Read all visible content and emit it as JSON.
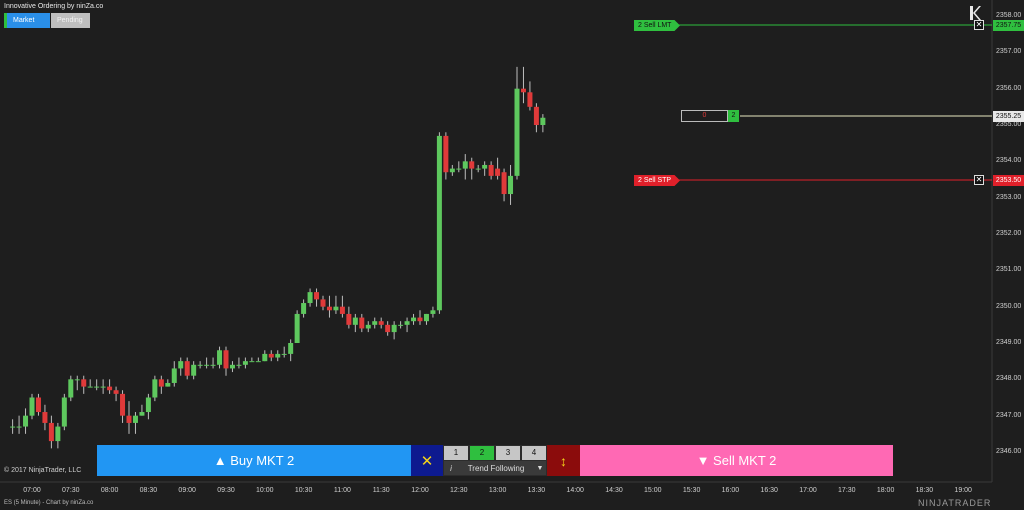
{
  "window": {
    "title": "Innovative Ordering by ninZa.co"
  },
  "mode_switch": {
    "market": "Market",
    "pending": "Pending"
  },
  "colors": {
    "background": "#1e1e1e",
    "up_candle": "#5ec85e",
    "down_candle": "#e03a3a",
    "sell_limit": "#2fbf3f",
    "sell_stop": "#e0202a",
    "position_line": "#e8e8c0",
    "buy_button": "#2196f3",
    "sell_button": "#ff69b4"
  },
  "price_axis": {
    "labels": [
      "2358.00",
      "2357.00",
      "2356.00",
      "2355.00",
      "2354.00",
      "2353.00",
      "2352.00",
      "2351.00",
      "2350.00",
      "2349.00",
      "2348.00",
      "2347.00",
      "2346.00"
    ]
  },
  "time_axis": {
    "labels": [
      "07:00",
      "07:30",
      "08:00",
      "08:30",
      "09:00",
      "09:30",
      "10:00",
      "10:30",
      "11:00",
      "11:30",
      "12:00",
      "12:30",
      "13:00",
      "13:30",
      "14:00",
      "14:30",
      "15:00",
      "15:30",
      "16:00",
      "16:30",
      "17:00",
      "17:30",
      "18:00",
      "18:30",
      "19:00"
    ]
  },
  "orders": {
    "sell_limit": {
      "tag": "2  Sell LMT",
      "price": "2357.75",
      "close_icon": "close-x-icon"
    },
    "sell_stop": {
      "tag": "2  Sell STP",
      "price": "2353.50",
      "close_icon": "close-x-icon"
    },
    "position": {
      "pnl": "0",
      "qty": "2",
      "price": "2355.25"
    }
  },
  "toolbar": {
    "buy_label": "▲ Buy MKT 2",
    "close_all_symbol": "✕",
    "quantities": [
      "1",
      "2",
      "3",
      "4"
    ],
    "active_quantity": "2",
    "info_symbol": "i",
    "strategy": "Trend Following",
    "reverse_symbol": "↕",
    "sell_label": "▼ Sell MKT 2"
  },
  "copyright": "© 2017 NinjaTrader, LLC",
  "footer": "ES (5 Minute) - Chart by ninZa.co",
  "logo_text": "NINJATRADER",
  "chart_data": {
    "type": "candlestick",
    "instrument": "ES (5 Minute)",
    "ylim": [
      2346,
      2358
    ],
    "candles": [
      {
        "time": "06:45",
        "open": 2346.7,
        "high": 2346.9,
        "low": 2346.5,
        "close": 2346.7
      },
      {
        "time": "06:50",
        "open": 2346.7,
        "high": 2347.0,
        "low": 2346.5,
        "close": 2346.7
      },
      {
        "time": "06:55",
        "open": 2346.7,
        "high": 2347.2,
        "low": 2346.5,
        "close": 2347.0
      },
      {
        "time": "07:00",
        "open": 2347.0,
        "high": 2347.6,
        "low": 2346.9,
        "close": 2347.5
      },
      {
        "time": "07:05",
        "open": 2347.5,
        "high": 2347.6,
        "low": 2347.0,
        "close": 2347.1
      },
      {
        "time": "07:10",
        "open": 2347.1,
        "high": 2347.3,
        "low": 2346.6,
        "close": 2346.8
      },
      {
        "time": "07:15",
        "open": 2346.8,
        "high": 2347.0,
        "low": 2346.1,
        "close": 2346.3
      },
      {
        "time": "07:20",
        "open": 2346.3,
        "high": 2346.8,
        "low": 2346.1,
        "close": 2346.7
      },
      {
        "time": "07:25",
        "open": 2346.7,
        "high": 2347.6,
        "low": 2346.6,
        "close": 2347.5
      },
      {
        "time": "07:30",
        "open": 2347.5,
        "high": 2348.1,
        "low": 2347.4,
        "close": 2348.0
      },
      {
        "time": "07:35",
        "open": 2348.0,
        "high": 2348.1,
        "low": 2347.7,
        "close": 2348.0
      },
      {
        "time": "07:40",
        "open": 2348.0,
        "high": 2348.1,
        "low": 2347.6,
        "close": 2347.8
      },
      {
        "time": "07:45",
        "open": 2347.8,
        "high": 2348.0,
        "low": 2347.8,
        "close": 2347.8
      },
      {
        "time": "07:50",
        "open": 2347.8,
        "high": 2348.0,
        "low": 2347.7,
        "close": 2347.8
      },
      {
        "time": "07:55",
        "open": 2347.8,
        "high": 2348.0,
        "low": 2347.6,
        "close": 2347.8
      },
      {
        "time": "08:00",
        "open": 2347.8,
        "high": 2348.0,
        "low": 2347.6,
        "close": 2347.7
      },
      {
        "time": "08:05",
        "open": 2347.7,
        "high": 2347.8,
        "low": 2347.4,
        "close": 2347.6
      },
      {
        "time": "08:10",
        "open": 2347.6,
        "high": 2347.7,
        "low": 2346.8,
        "close": 2347.0
      },
      {
        "time": "08:15",
        "open": 2347.0,
        "high": 2347.4,
        "low": 2346.5,
        "close": 2346.8
      },
      {
        "time": "08:20",
        "open": 2346.8,
        "high": 2347.1,
        "low": 2346.5,
        "close": 2347.0
      },
      {
        "time": "08:25",
        "open": 2347.0,
        "high": 2347.3,
        "low": 2347.0,
        "close": 2347.1
      },
      {
        "time": "08:30",
        "open": 2347.1,
        "high": 2347.6,
        "low": 2346.9,
        "close": 2347.5
      },
      {
        "time": "08:35",
        "open": 2347.5,
        "high": 2348.1,
        "low": 2347.4,
        "close": 2348.0
      },
      {
        "time": "08:40",
        "open": 2348.0,
        "high": 2348.1,
        "low": 2347.6,
        "close": 2347.8
      },
      {
        "time": "08:45",
        "open": 2347.8,
        "high": 2348.0,
        "low": 2347.8,
        "close": 2347.9
      },
      {
        "time": "08:50",
        "open": 2347.9,
        "high": 2348.5,
        "low": 2347.8,
        "close": 2348.3
      },
      {
        "time": "08:55",
        "open": 2348.3,
        "high": 2348.6,
        "low": 2348.1,
        "close": 2348.5
      },
      {
        "time": "09:00",
        "open": 2348.5,
        "high": 2348.6,
        "low": 2348.0,
        "close": 2348.1
      },
      {
        "time": "09:05",
        "open": 2348.1,
        "high": 2348.5,
        "low": 2348.0,
        "close": 2348.4
      },
      {
        "time": "09:10",
        "open": 2348.4,
        "high": 2348.5,
        "low": 2348.3,
        "close": 2348.4
      },
      {
        "time": "09:15",
        "open": 2348.4,
        "high": 2348.6,
        "low": 2348.3,
        "close": 2348.4
      },
      {
        "time": "09:20",
        "open": 2348.4,
        "high": 2348.6,
        "low": 2348.3,
        "close": 2348.4
      },
      {
        "time": "09:25",
        "open": 2348.4,
        "high": 2348.9,
        "low": 2348.3,
        "close": 2348.8
      },
      {
        "time": "09:30",
        "open": 2348.8,
        "high": 2348.9,
        "low": 2348.1,
        "close": 2348.3
      },
      {
        "time": "09:35",
        "open": 2348.3,
        "high": 2348.5,
        "low": 2348.2,
        "close": 2348.4
      },
      {
        "time": "09:40",
        "open": 2348.4,
        "high": 2348.6,
        "low": 2348.3,
        "close": 2348.4
      },
      {
        "time": "09:45",
        "open": 2348.4,
        "high": 2348.6,
        "low": 2348.3,
        "close": 2348.5
      },
      {
        "time": "09:50",
        "open": 2348.5,
        "high": 2348.6,
        "low": 2348.5,
        "close": 2348.5
      },
      {
        "time": "09:55",
        "open": 2348.5,
        "high": 2348.6,
        "low": 2348.5,
        "close": 2348.5
      },
      {
        "time": "10:00",
        "open": 2348.5,
        "high": 2348.8,
        "low": 2348.5,
        "close": 2348.7
      },
      {
        "time": "10:05",
        "open": 2348.7,
        "high": 2348.8,
        "low": 2348.5,
        "close": 2348.6
      },
      {
        "time": "10:10",
        "open": 2348.6,
        "high": 2348.8,
        "low": 2348.5,
        "close": 2348.7
      },
      {
        "time": "10:15",
        "open": 2348.7,
        "high": 2348.9,
        "low": 2348.6,
        "close": 2348.7
      },
      {
        "time": "10:20",
        "open": 2348.7,
        "high": 2349.1,
        "low": 2348.5,
        "close": 2349.0
      },
      {
        "time": "10:25",
        "open": 2349.0,
        "high": 2349.9,
        "low": 2349.0,
        "close": 2349.8
      },
      {
        "time": "10:30",
        "open": 2349.8,
        "high": 2350.2,
        "low": 2349.7,
        "close": 2350.1
      },
      {
        "time": "10:35",
        "open": 2350.1,
        "high": 2350.5,
        "low": 2350.0,
        "close": 2350.4
      },
      {
        "time": "10:40",
        "open": 2350.4,
        "high": 2350.5,
        "low": 2350.0,
        "close": 2350.2
      },
      {
        "time": "10:45",
        "open": 2350.2,
        "high": 2350.3,
        "low": 2349.9,
        "close": 2350.0
      },
      {
        "time": "10:50",
        "open": 2350.0,
        "high": 2350.3,
        "low": 2349.7,
        "close": 2349.9
      },
      {
        "time": "10:55",
        "open": 2349.9,
        "high": 2350.3,
        "low": 2349.8,
        "close": 2350.0
      },
      {
        "time": "11:00",
        "open": 2350.0,
        "high": 2350.3,
        "low": 2349.7,
        "close": 2349.8
      },
      {
        "time": "11:05",
        "open": 2349.8,
        "high": 2350.0,
        "low": 2349.4,
        "close": 2349.5
      },
      {
        "time": "11:10",
        "open": 2349.5,
        "high": 2349.8,
        "low": 2349.3,
        "close": 2349.7
      },
      {
        "time": "11:15",
        "open": 2349.7,
        "high": 2349.8,
        "low": 2349.3,
        "close": 2349.4
      },
      {
        "time": "11:20",
        "open": 2349.4,
        "high": 2349.6,
        "low": 2349.3,
        "close": 2349.5
      },
      {
        "time": "11:25",
        "open": 2349.5,
        "high": 2349.7,
        "low": 2349.4,
        "close": 2349.6
      },
      {
        "time": "11:30",
        "open": 2349.6,
        "high": 2349.7,
        "low": 2349.4,
        "close": 2349.5
      },
      {
        "time": "11:35",
        "open": 2349.5,
        "high": 2349.6,
        "low": 2349.2,
        "close": 2349.3
      },
      {
        "time": "11:40",
        "open": 2349.3,
        "high": 2349.6,
        "low": 2349.1,
        "close": 2349.5
      },
      {
        "time": "11:45",
        "open": 2349.5,
        "high": 2349.6,
        "low": 2349.4,
        "close": 2349.5
      },
      {
        "time": "11:50",
        "open": 2349.5,
        "high": 2349.7,
        "low": 2349.3,
        "close": 2349.6
      },
      {
        "time": "11:55",
        "open": 2349.6,
        "high": 2349.8,
        "low": 2349.5,
        "close": 2349.7
      },
      {
        "time": "12:00",
        "open": 2349.7,
        "high": 2349.9,
        "low": 2349.5,
        "close": 2349.6
      },
      {
        "time": "12:05",
        "open": 2349.6,
        "high": 2349.8,
        "low": 2349.5,
        "close": 2349.8
      },
      {
        "time": "12:10",
        "open": 2349.8,
        "high": 2350.0,
        "low": 2349.7,
        "close": 2349.9
      },
      {
        "time": "12:15",
        "open": 2349.9,
        "high": 2354.8,
        "low": 2349.8,
        "close": 2354.7
      },
      {
        "time": "12:20",
        "open": 2354.7,
        "high": 2354.8,
        "low": 2353.5,
        "close": 2353.7
      },
      {
        "time": "12:25",
        "open": 2353.7,
        "high": 2353.9,
        "low": 2353.6,
        "close": 2353.8
      },
      {
        "time": "12:30",
        "open": 2353.8,
        "high": 2354.0,
        "low": 2353.7,
        "close": 2353.8
      },
      {
        "time": "12:35",
        "open": 2353.8,
        "high": 2354.2,
        "low": 2353.5,
        "close": 2354.0
      },
      {
        "time": "12:40",
        "open": 2354.0,
        "high": 2354.1,
        "low": 2353.5,
        "close": 2353.8
      },
      {
        "time": "12:45",
        "open": 2353.8,
        "high": 2353.9,
        "low": 2353.7,
        "close": 2353.8
      },
      {
        "time": "12:50",
        "open": 2353.8,
        "high": 2354.0,
        "low": 2353.6,
        "close": 2353.9
      },
      {
        "time": "12:55",
        "open": 2353.9,
        "high": 2354.0,
        "low": 2353.5,
        "close": 2353.6
      },
      {
        "time": "13:00",
        "open": 2353.8,
        "high": 2354.1,
        "low": 2353.5,
        "close": 2353.6
      },
      {
        "time": "13:05",
        "open": 2353.7,
        "high": 2353.8,
        "low": 2352.9,
        "close": 2353.1
      },
      {
        "time": "13:10",
        "open": 2353.1,
        "high": 2353.9,
        "low": 2352.8,
        "close": 2353.6
      },
      {
        "time": "13:15",
        "open": 2353.6,
        "high": 2356.6,
        "low": 2353.5,
        "close": 2356.0
      },
      {
        "time": "13:20",
        "open": 2356.0,
        "high": 2356.6,
        "low": 2355.6,
        "close": 2355.9
      },
      {
        "time": "13:25",
        "open": 2355.9,
        "high": 2356.2,
        "low": 2355.4,
        "close": 2355.5
      },
      {
        "time": "13:30",
        "open": 2355.5,
        "high": 2355.6,
        "low": 2354.8,
        "close": 2355.0
      },
      {
        "time": "13:35",
        "open": 2355.0,
        "high": 2355.3,
        "low": 2354.8,
        "close": 2355.2
      }
    ]
  }
}
